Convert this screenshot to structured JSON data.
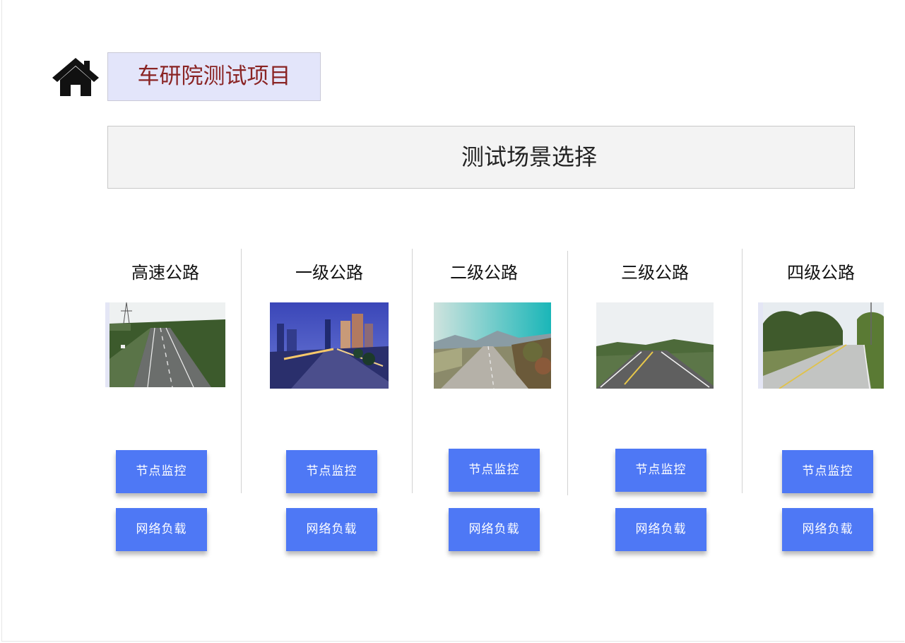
{
  "header": {
    "home_icon": "home-icon",
    "project_title": "车研院测试项目"
  },
  "scene": {
    "title": "测试场景选择"
  },
  "theme": {
    "title_bg": "#e3e5fa",
    "title_color": "#8a2424",
    "button_color": "#4e78f5"
  },
  "columns": [
    {
      "title": "高速公路",
      "image": "highway-photo",
      "monitor_label": "节点监控",
      "network_label": "网络负载"
    },
    {
      "title": "一级公路",
      "image": "first-class-road-photo",
      "monitor_label": "节点监控",
      "network_label": "网络负载"
    },
    {
      "title": "二级公路",
      "image": "second-class-road-photo",
      "monitor_label": "节点监控",
      "network_label": "网络负载"
    },
    {
      "title": "三级公路",
      "image": "third-class-road-photo",
      "monitor_label": "节点监控",
      "network_label": "网络负载"
    },
    {
      "title": "四级公路",
      "image": "fourth-class-road-photo",
      "monitor_label": "节点监控",
      "network_label": "网络负载"
    }
  ]
}
